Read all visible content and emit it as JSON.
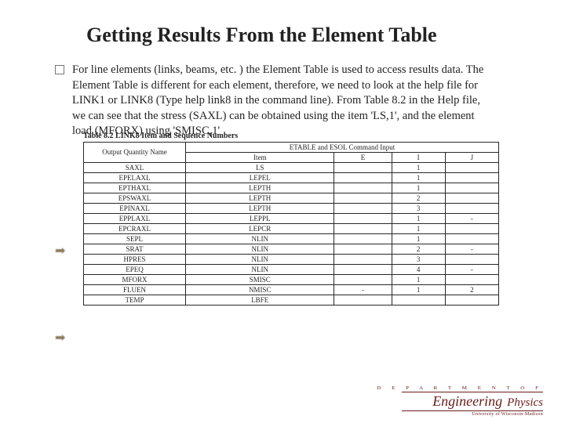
{
  "title": "Getting Results From the Element Table",
  "body": "For line elements (links, beams, etc. ) the Element Table is used to access results data. The Element Table is different for each element, therefore, we need to look at the help file for LINK1 or LINK8 (Type help link8 in the command line). From Table 8.2 in the Help file, we can see that the stress (SAXL) can be obtained using the item 'LS,1', and the element load (MFORX) using 'SMISC,1'",
  "table_caption": "Table 8.2  LINK8 Item and Sequence Numbers",
  "table_header1": "Output Quantity Name",
  "table_header2": "ETABLE and ESOL Command Input",
  "cols": {
    "c1": "Item",
    "c2": "E",
    "c3": "I",
    "c4": "J"
  },
  "rows": [
    {
      "name": "SAXL",
      "item": "LS",
      "e": "",
      "i": "1",
      "j": ""
    },
    {
      "name": "EPELAXL",
      "item": "LEPEL",
      "e": "",
      "i": "1",
      "j": ""
    },
    {
      "name": "EPTHAXL",
      "item": "LEPTH",
      "e": "",
      "i": "1",
      "j": ""
    },
    {
      "name": "EPSWAXL",
      "item": "LEPTH",
      "e": "",
      "i": "2",
      "j": ""
    },
    {
      "name": "EPINAXL",
      "item": "LEPTH",
      "e": "",
      "i": "3",
      "j": ""
    },
    {
      "name": "EPPLAXL",
      "item": "LEPPL",
      "e": "",
      "i": "1",
      "j": "-"
    },
    {
      "name": "EPCRAXL",
      "item": "LEPCR",
      "e": "",
      "i": "1",
      "j": ""
    },
    {
      "name": "SEPL",
      "item": "NLIN",
      "e": "",
      "i": "1",
      "j": ""
    },
    {
      "name": "SRAT",
      "item": "NLIN",
      "e": "",
      "i": "2",
      "j": "-"
    },
    {
      "name": "HPRES",
      "item": "NLIN",
      "e": "",
      "i": "3",
      "j": ""
    },
    {
      "name": "EPEQ",
      "item": "NLIN",
      "e": "",
      "i": "4",
      "j": "-"
    },
    {
      "name": "MFORX",
      "item": "SMISC",
      "e": "",
      "i": "1",
      "j": ""
    },
    {
      "name": "FLUEN",
      "item": "NMISC",
      "e": "-",
      "i": "1",
      "j": "2"
    },
    {
      "name": "TEMP",
      "item": "LBFE",
      "e": "",
      "i": "",
      "j": ""
    }
  ],
  "footer": {
    "dept": "D E P A R T M E N T   O F",
    "eng": "Engineering",
    "phy": "Physics",
    "uni": "University of Wisconsin-Madison"
  }
}
